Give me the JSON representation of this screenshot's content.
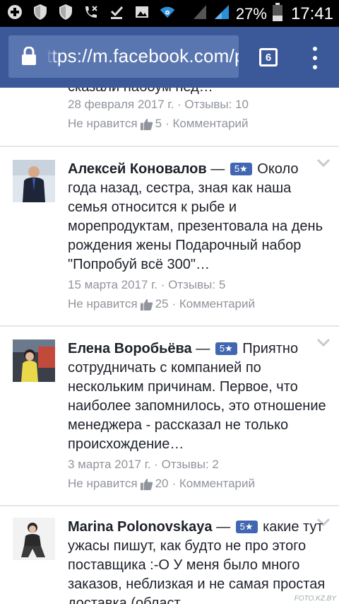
{
  "status_bar": {
    "battery_percent": "27%",
    "time": "17:41",
    "left_icons": [
      "add-box-icon",
      "shield-icon",
      "shield-icon",
      "missed-call-icon",
      "download-done-icon",
      "image-icon",
      "vpn-wifi-icon"
    ],
    "right_icons": [
      "signal-empty-icon",
      "signal-icon",
      "battery-icon"
    ]
  },
  "browser": {
    "url": "ttps://m.facebook.com/p",
    "tab_count": "6"
  },
  "feed": {
    "partial_top": {
      "text_tail": "сказали набоум  нед…",
      "meta": "28 февраля 2017 г. · Отзывы: 10",
      "dislike_label": "Не нравится",
      "like_count": "5",
      "comment_label": "· Комментарий"
    },
    "reviews": [
      {
        "author": "Алексей Коновалов",
        "dash": " — ",
        "rating": "5★",
        "text": " Около года назад, сестра, зная как наша семья относится к рыбе и морепродуктам, презентовала на день рождения жены Подарочный набор \"Попробуй всё 300\"…",
        "meta": "15 марта 2017 г. · Отзывы: 5",
        "dislike_label": "Не нравится",
        "like_count": "25",
        "comment_label": "· Комментарий"
      },
      {
        "author": "Елена Воробьёва",
        "dash": " — ",
        "rating": "5★",
        "text": " Приятно сотрудничать с компанией по нескольким причинам. Первое, что наиболее запомнилось, это отношение менеджера - рассказал не только происхождение…",
        "meta": "3 марта 2017 г. · Отзывы: 2",
        "dislike_label": "Не нравится",
        "like_count": "20",
        "comment_label": "· Комментарий"
      },
      {
        "author": "Marina Polonovskaya",
        "dash": " — ",
        "rating": "5★",
        "text": " какие тут ужасы пишут, как будто не про этого поставщика :-О У меня было много заказов, неблизкая и не самая простая доставка (област…"
      }
    ]
  },
  "watermark": "FOTO.KZ.BY",
  "colors": {
    "facebook_blue": "#3b5998",
    "url_bar": "#5a76b0",
    "badge_blue": "#4267b2",
    "meta_gray": "#90949c"
  }
}
